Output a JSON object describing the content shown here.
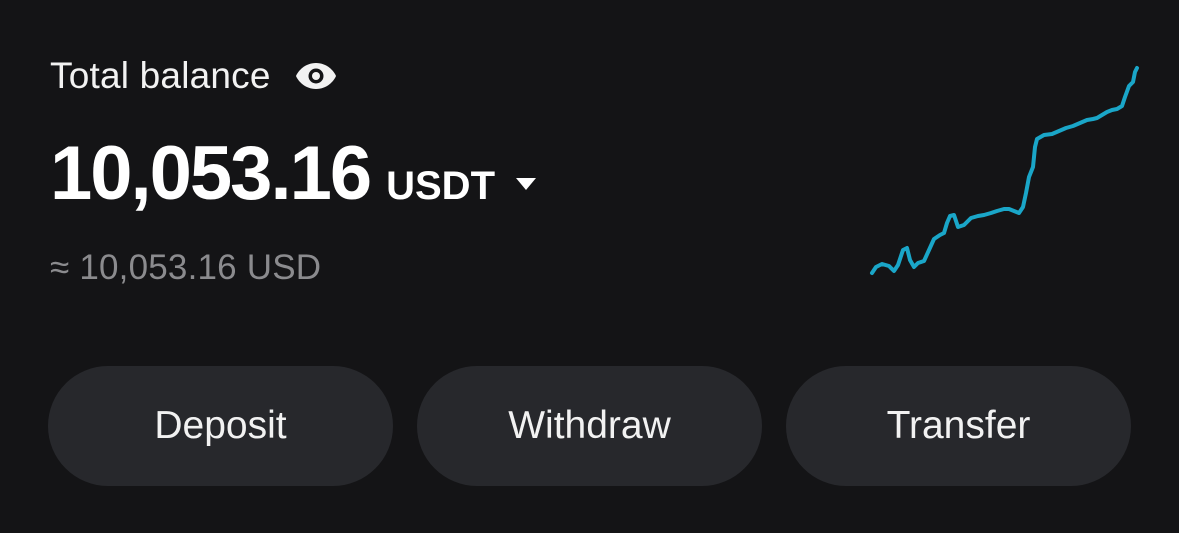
{
  "balance": {
    "label": "Total balance",
    "amount": "10,053.16",
    "currency": "USDT",
    "fiat_equivalent": "≈ 10,053.16 USD"
  },
  "icons": {
    "visibility": "eye-icon",
    "currency_dropdown": "caret-down-icon"
  },
  "sparkline": {
    "color": "#1aa6c8",
    "trend": "rising"
  },
  "actions": {
    "deposit": "Deposit",
    "withdraw": "Withdraw",
    "transfer": "Transfer"
  },
  "colors": {
    "background": "#141416",
    "button_bg": "#27282c",
    "muted_text": "#8b8b8e",
    "accent": "#1aa6c8"
  }
}
